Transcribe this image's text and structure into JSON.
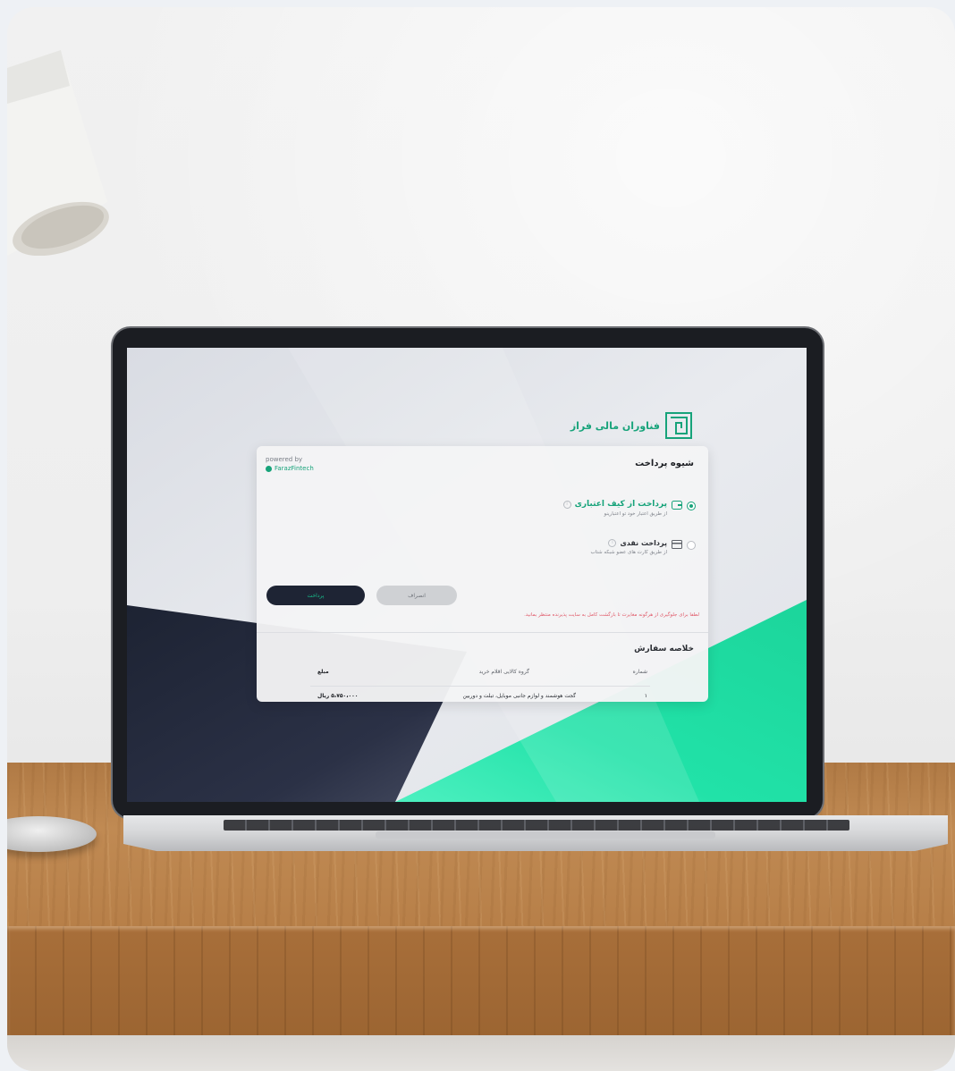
{
  "brand": {
    "name": "فناوران مالی فراز",
    "color": "#17a37a"
  },
  "payment": {
    "title": "شیوه پرداخت",
    "powered_by": "powered by",
    "provider": "FarazFintech",
    "options": [
      {
        "label": "پرداخت از کیف اعتباری",
        "description": "از طریق اعتبار خود تو اعتبارینو",
        "selected": true,
        "icon": "wallet-icon"
      },
      {
        "label": "پرداخت نقدی",
        "description": "از طریق کارت های عضو شبکه شتاب",
        "selected": false,
        "icon": "card-icon"
      }
    ],
    "pay_button": "پرداخت",
    "cancel_button": "انصراف",
    "warning": "لطفا برای جلوگیری از هرگونه مغایرت تا بازگشت کامل به سایت پذیرنده منتظر بمانید."
  },
  "order_summary": {
    "title": "خلاصه سفارش",
    "columns": [
      "شماره",
      "گروه کالایی اقلام خرید",
      "مبلغ"
    ],
    "rows": [
      {
        "number": "۱",
        "group": "گجت هوشمند و لوازم جانبی موبایل، تبلت و دوربین",
        "amount": "۵،۷۵۰،۰۰۰ ریال"
      }
    ]
  },
  "colors": {
    "accent": "#17a37a",
    "dark": "#1e2434",
    "warning": "#e05a6a"
  }
}
